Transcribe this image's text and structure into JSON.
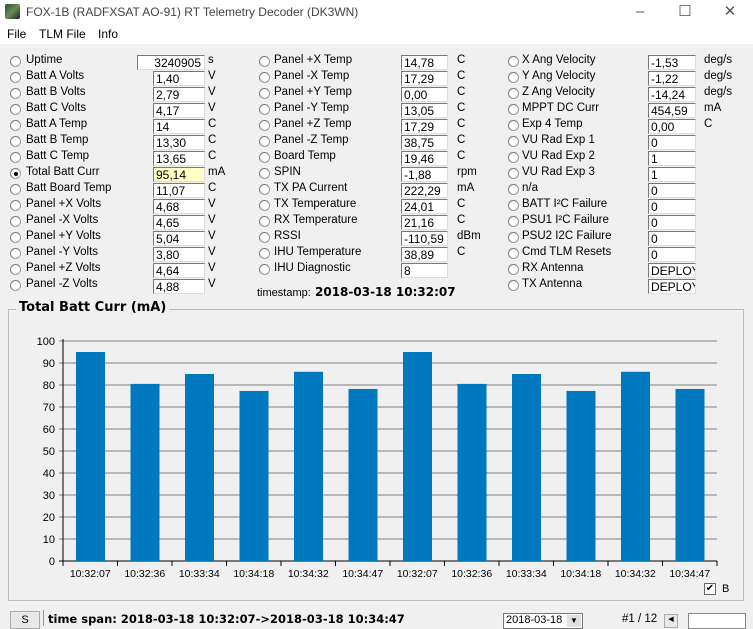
{
  "window": {
    "title": "FOX-1B (RADFXSAT AO-91) RT Telemetry Decoder  (DK3WN)"
  },
  "menu": [
    "File",
    "TLM File",
    "Info"
  ],
  "columns": [
    [
      {
        "label": "Uptime",
        "value": "3240905",
        "unit": "s",
        "wide": true
      },
      {
        "label": "Batt A Volts",
        "value": "1,40",
        "unit": "V"
      },
      {
        "label": "Batt B Volts",
        "value": "2,79",
        "unit": "V"
      },
      {
        "label": "Batt C Volts",
        "value": "4,17",
        "unit": "V"
      },
      {
        "label": "Batt A Temp",
        "value": "14",
        "unit": "C"
      },
      {
        "label": "Batt B Temp",
        "value": "13,30",
        "unit": "C"
      },
      {
        "label": "Batt C Temp",
        "value": "13,65",
        "unit": "C"
      },
      {
        "label": "Total Batt Curr",
        "value": "95,14",
        "unit": "mA",
        "selected": true
      },
      {
        "label": "Batt Board Temp",
        "value": "11,07",
        "unit": "C"
      },
      {
        "label": "Panel +X Volts",
        "value": "4,68",
        "unit": "V"
      },
      {
        "label": "Panel -X Volts",
        "value": "4,65",
        "unit": "V"
      },
      {
        "label": "Panel +Y Volts",
        "value": "5,04",
        "unit": "V"
      },
      {
        "label": "Panel -Y Volts",
        "value": "3,80",
        "unit": "V"
      },
      {
        "label": "Panel +Z Volts",
        "value": "4,64",
        "unit": "V"
      },
      {
        "label": "Panel -Z Volts",
        "value": "4,88",
        "unit": "V"
      }
    ],
    [
      {
        "label": "Panel +X Temp",
        "value": "14,78",
        "unit": "C"
      },
      {
        "label": "Panel -X Temp",
        "value": "17,29",
        "unit": "C"
      },
      {
        "label": "Panel +Y Temp",
        "value": "0,00",
        "unit": "C"
      },
      {
        "label": "Panel -Y Temp",
        "value": "13,05",
        "unit": "C"
      },
      {
        "label": "Panel +Z Temp",
        "value": "17,29",
        "unit": "C"
      },
      {
        "label": "Panel -Z Temp",
        "value": "38,75",
        "unit": "C"
      },
      {
        "label": "Board Temp",
        "value": "19,46",
        "unit": "C"
      },
      {
        "label": "SPIN",
        "value": "-1,88",
        "unit": "rpm"
      },
      {
        "label": "TX PA Current",
        "value": "222,29",
        "unit": "mA"
      },
      {
        "label": "TX Temperature",
        "value": "24,01",
        "unit": "C"
      },
      {
        "label": "RX Temperature",
        "value": "21,16",
        "unit": "C"
      },
      {
        "label": "RSSI",
        "value": "-110,59",
        "unit": "dBm"
      },
      {
        "label": "IHU Temperature",
        "value": "38,89",
        "unit": "C"
      },
      {
        "label": "IHU Diagnostic",
        "value": "8",
        "unit": ""
      }
    ],
    [
      {
        "label": "X Ang Velocity",
        "value": "-1,53",
        "unit": "deg/s"
      },
      {
        "label": "Y Ang Velocity",
        "value": "-1,22",
        "unit": "deg/s"
      },
      {
        "label": "Z Ang Velocity",
        "value": "-14,24",
        "unit": "deg/s"
      },
      {
        "label": "MPPT DC Curr",
        "value": "454,59",
        "unit": "mA"
      },
      {
        "label": "Exp 4 Temp",
        "value": "0,00",
        "unit": "C"
      },
      {
        "label": "VU Rad Exp 1",
        "value": "0",
        "unit": ""
      },
      {
        "label": "VU Rad Exp 2",
        "value": "1",
        "unit": ""
      },
      {
        "label": "VU Rad Exp 3",
        "value": "1",
        "unit": ""
      },
      {
        "label": "n/a",
        "value": "0",
        "unit": ""
      },
      {
        "label": "BATT I²C Failure",
        "value": "0",
        "unit": ""
      },
      {
        "label": "PSU1 I²C Failure",
        "value": "0",
        "unit": ""
      },
      {
        "label": "PSU2 I2C Failure",
        "value": "0",
        "unit": ""
      },
      {
        "label": "Cmd TLM Resets",
        "value": "0",
        "unit": ""
      },
      {
        "label": "RX Antenna",
        "value": "DEPLOY",
        "unit": ""
      },
      {
        "label": "TX Antenna",
        "value": "DEPLOY",
        "unit": ""
      }
    ]
  ],
  "timestamp": {
    "label": "timestamp:",
    "value": "2018-03-18 10:32:07"
  },
  "chart_data": {
    "type": "bar",
    "title": "Total Batt Curr (mA)",
    "categories": [
      "10:32:07",
      "10:32:36",
      "10:33:34",
      "10:34:18",
      "10:34:32",
      "10:34:47",
      "10:32:07",
      "10:32:36",
      "10:33:34",
      "10:34:18",
      "10:34:32",
      "10:34:47"
    ],
    "values": [
      95,
      80.5,
      85,
      77.3,
      86,
      78.2,
      95,
      80.5,
      85,
      77.3,
      86,
      78.2
    ],
    "ylim": [
      0,
      100
    ],
    "yticks": [
      0,
      10,
      20,
      30,
      40,
      50,
      60,
      70,
      80,
      90,
      100
    ],
    "grid": true,
    "bar_color": "#0078c0"
  },
  "checkbox_b": {
    "label": "B",
    "checked": true
  },
  "footer": {
    "s_button": "S",
    "time_span": "time span: 2018-03-18 10:32:07->2018-03-18 10:34:47",
    "date": "2018-03-18",
    "record": "#1 / 12"
  }
}
